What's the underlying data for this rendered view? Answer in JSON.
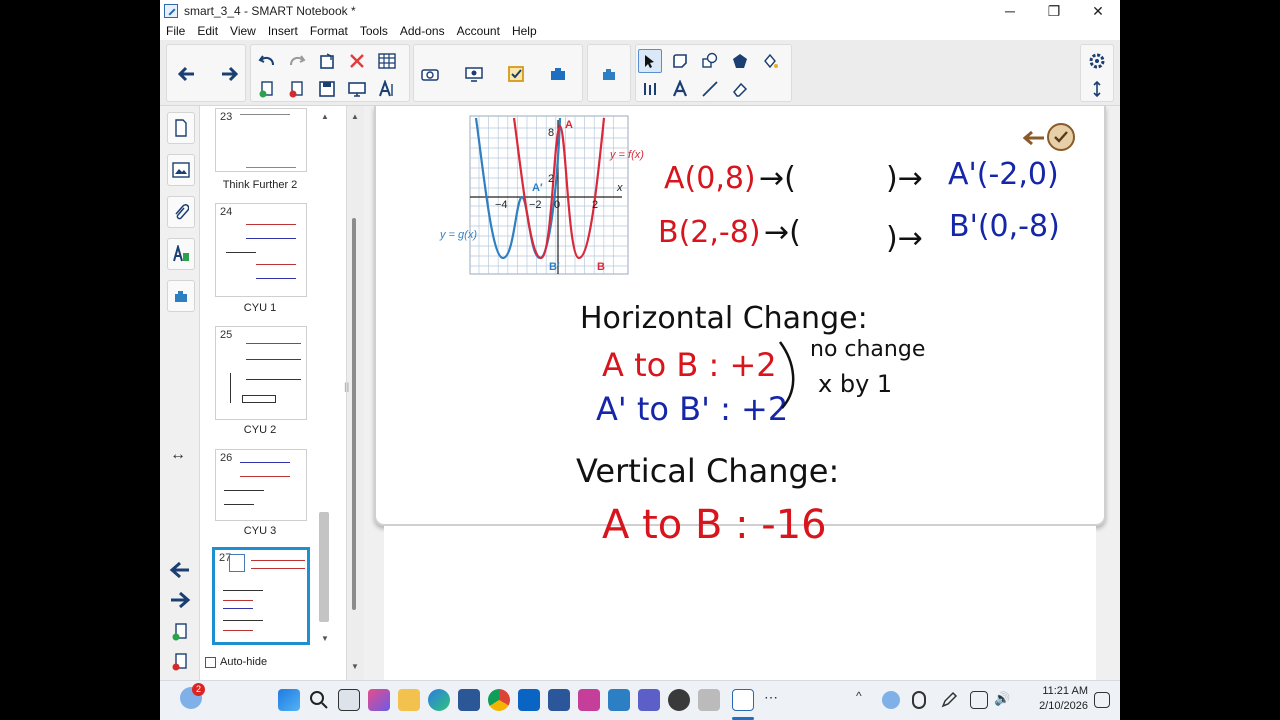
{
  "window": {
    "title": "smart_3_4 - SMART Notebook *",
    "minimize": "─",
    "maximize": "❐",
    "close": "✕"
  },
  "menu": [
    "File",
    "Edit",
    "View",
    "Insert",
    "Format",
    "Tools",
    "Add-ons",
    "Account",
    "Help"
  ],
  "toolbar": {
    "icons": [
      "back-arrow-icon",
      "forward-arrow-icon",
      "undo-icon",
      "redo-icon",
      "delete-icon",
      "table-icon",
      "new-page-icon",
      "delete-page-icon",
      "save-icon",
      "screen-shade-icon",
      "text-recognition-icon",
      "camera-icon",
      "document-camera-icon",
      "response-icon",
      "add-ons-icon",
      "widgets-icon",
      "select-icon",
      "pen-icon",
      "shapes-icon",
      "eraser-tool-icon",
      "fill-icon",
      "measure-icon",
      "text-icon",
      "line-icon",
      "eraser-icon",
      "settings-gear-icon",
      "move-toolbar-icon"
    ]
  },
  "sidebar_tabs": [
    "page-sorter-icon",
    "gallery-icon",
    "attachments-icon",
    "properties-icon",
    "add-ons-tab-icon"
  ],
  "pages": [
    {
      "num": "23",
      "label": "Think Further 2"
    },
    {
      "num": "24",
      "label": "CYU 1"
    },
    {
      "num": "25",
      "label": "CYU 2"
    },
    {
      "num": "26",
      "label": "CYU 3"
    },
    {
      "num": "27",
      "label": ""
    }
  ],
  "autohide_label": "Auto-hide",
  "graph": {
    "f_label": "y = f(x)",
    "g_label": "y = g(x)",
    "x_axis_label": "x",
    "tick_neg4": "−4",
    "tick_neg2": "−2",
    "tick_0": "0",
    "tick_2": "2",
    "tick_8": "8",
    "tick_2y": "2",
    "point_A": "A",
    "point_Ap": "A′",
    "point_B": "B",
    "point_Bp": "B′"
  },
  "notes": {
    "line1_left": "A(0,8)",
    "line1_mid": "→(",
    "line1_close": ")→",
    "line1_right": "A'(-2,0)",
    "line2_left": "B(2,-8)",
    "line2_mid": "→(",
    "line2_close": ")→",
    "line2_right": "B'(0,-8)",
    "horizontal_heading": "Horizontal Change:",
    "h_line1": "A to B : +2",
    "h_line2": "A' to B' : +2",
    "h_note1": "no change",
    "h_note2": "x by 1",
    "vertical_heading": "Vertical Change:",
    "v_line1": "A to B : -16"
  },
  "taskbar": {
    "time": "11:21 AM",
    "date": "2/10/2026",
    "badge": "2"
  },
  "colors": {
    "red_ink": "#d8141c",
    "blue_ink": "#1526a8",
    "black_ink": "#111111",
    "f_curve": "#d9293a",
    "g_curve": "#2f7fc1",
    "accent": "#1e6fbf"
  }
}
